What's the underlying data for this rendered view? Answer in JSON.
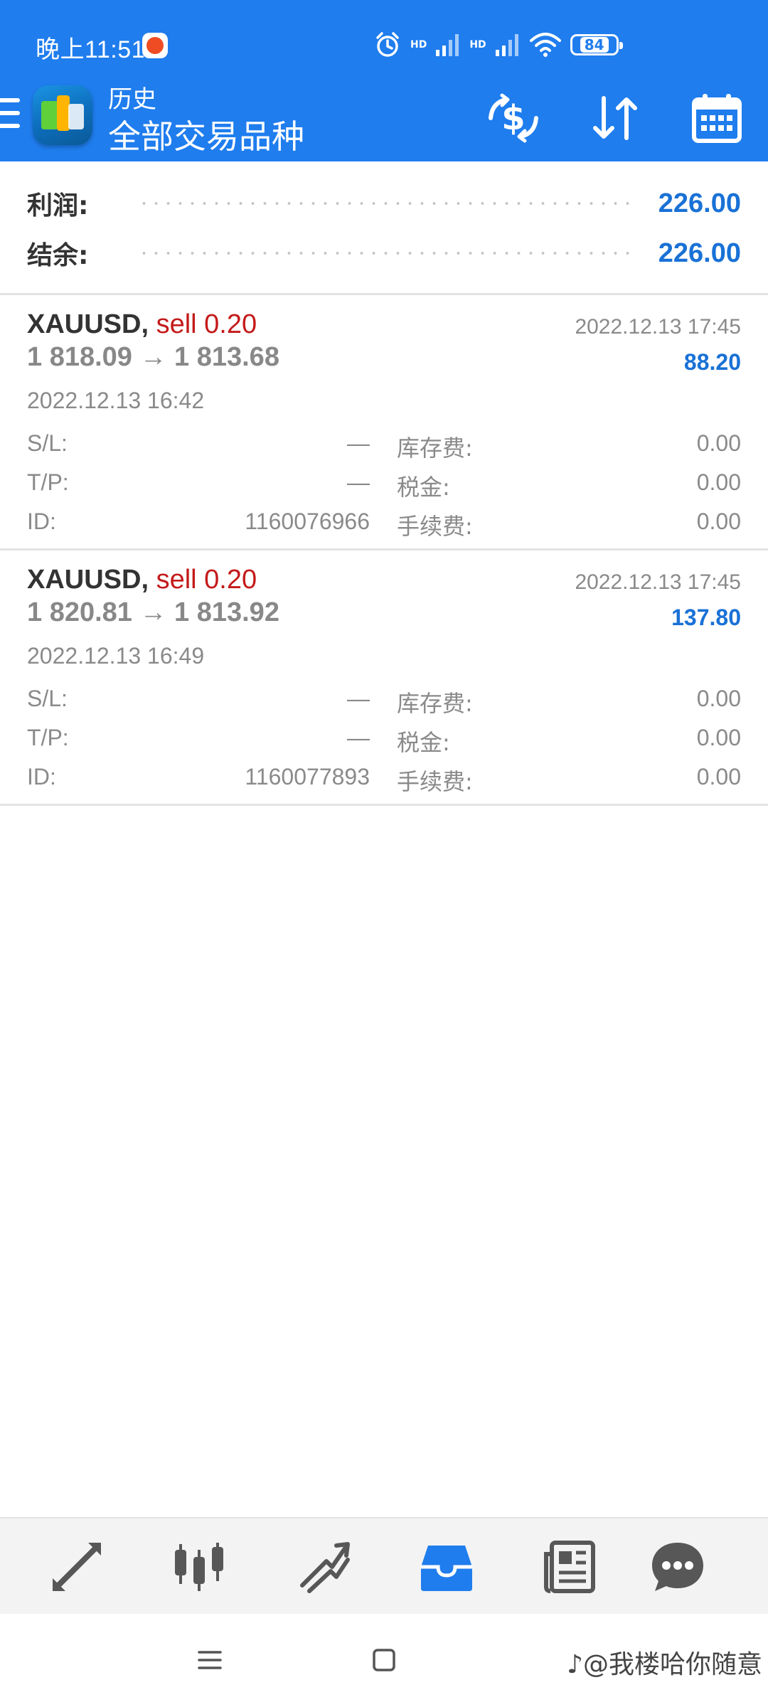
{
  "status_bar": {
    "time": "晚上11:51",
    "hd_label": "HD",
    "battery": "84"
  },
  "app_bar": {
    "subtitle": "历史",
    "title": "全部交易品种"
  },
  "summary": {
    "profit_label": "利润:",
    "profit_value": "226.00",
    "balance_label": "结余:",
    "balance_value": "226.00"
  },
  "deals": [
    {
      "symbol": "XAUUSD,",
      "side": "sell 0.20",
      "close_time": "2022.12.13 17:45",
      "prices": "1 818.09 → 1 813.68",
      "profit": "88.20",
      "open_time": "2022.12.13 16:42",
      "sl_label": "S/L:",
      "sl_value": "—",
      "tp_label": "T/P:",
      "tp_value": "—",
      "id_label": "ID:",
      "id_value": "1160076966",
      "swap_label": "库存费:",
      "swap_value": "0.00",
      "tax_label": "税金:",
      "tax_value": "0.00",
      "commission_label": "手续费:",
      "commission_value": "0.00"
    },
    {
      "symbol": "XAUUSD,",
      "side": "sell 0.20",
      "close_time": "2022.12.13 17:45",
      "prices": "1 820.81 → 1 813.92",
      "profit": "137.80",
      "open_time": "2022.12.13 16:49",
      "sl_label": "S/L:",
      "sl_value": "—",
      "tp_label": "T/P:",
      "tp_value": "—",
      "id_label": "ID:",
      "id_value": "1160077893",
      "swap_label": "库存费:",
      "swap_value": "0.00",
      "tax_label": "税金:",
      "tax_value": "0.00",
      "commission_label": "手续费:",
      "commission_value": "0.00"
    }
  ],
  "bottom_nav": {
    "icons": [
      "quotes-icon",
      "chart-icon",
      "trade-icon",
      "history-icon",
      "news-icon",
      "chat-icon"
    ],
    "active": "history-icon"
  },
  "watermark": "♪@我楼哈你随意",
  "colors": {
    "primary": "#1f7dee",
    "value_blue": "#1971d6",
    "sell_red": "#c41a1a",
    "muted_gray": "#8a8a8a",
    "nav_gray": "#575757"
  }
}
